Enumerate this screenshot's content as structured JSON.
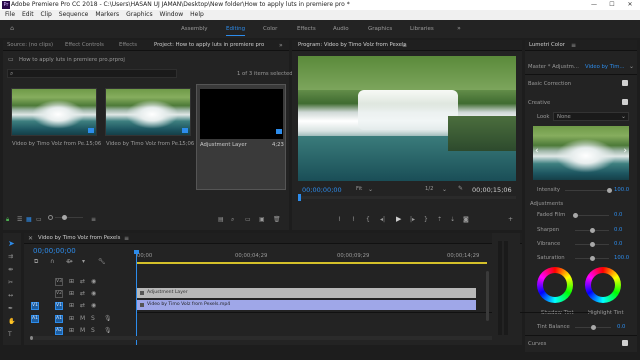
{
  "titlebar": {
    "title": "Adobe Premiere Pro CC 2018 - C:\\Users\\HASAN UJ JAMAN\\Desktop\\New folder\\How to apply luts in premiere pro *",
    "app_icon": "Pr"
  },
  "menubar": [
    "File",
    "Edit",
    "Clip",
    "Sequence",
    "Markers",
    "Graphics",
    "Window",
    "Help"
  ],
  "workspaces": {
    "items": [
      "Assembly",
      "Editing",
      "Color",
      "Effects",
      "Audio",
      "Graphics",
      "Libraries"
    ],
    "active": "Editing"
  },
  "project_panel": {
    "tabs": [
      "Source: (no clips)",
      "Effect Controls",
      "Effects",
      "Project: How to apply luts in premiere pro"
    ],
    "project_file": "How to apply luts in premiere pro.prproj",
    "search_placeholder": "",
    "selection_info": "1 of 3 items selected",
    "items": [
      {
        "name": "Video by Timo Volz from Pe...",
        "duration": "15;06"
      },
      {
        "name": "Video by Timo Volz from Pe...",
        "duration": "15;06"
      },
      {
        "name": "Adjustment Layer",
        "duration": "4;23"
      }
    ]
  },
  "program_monitor": {
    "tab": "Program: Video by Timo Volz from Pexels",
    "timecode": "00;00;00;00",
    "fit": "Fit",
    "resolution": "1/2",
    "duration": "00;00;15;06"
  },
  "lumetri": {
    "tab": "Lumetri Color",
    "master": "Master * Adjustm...",
    "clip": "Video by Tim...",
    "basic_correction": "Basic Correction",
    "creative": "Creative",
    "look_label": "Look",
    "look_value": "None",
    "intensity_label": "Intensity",
    "intensity_value": "100.0",
    "intensity": 1.0,
    "adjustments": "Adjustments",
    "params": [
      {
        "label": "Faded Film",
        "value": "0.0",
        "level": 0.0
      },
      {
        "label": "Sharpen",
        "value": "0.0",
        "level": 0.5
      },
      {
        "label": "Vibrance",
        "value": "0.0",
        "level": 0.5
      },
      {
        "label": "Saturation",
        "value": "100.0",
        "level": 0.5
      }
    ],
    "shadow_tint": "Shadow Tint",
    "highlight_tint": "Highlight Tint",
    "tint_balance_label": "Tint Balance",
    "tint_balance_value": "0.0",
    "curves": "Curves"
  },
  "timeline": {
    "tab": "Video by Timo Volz from Pexels",
    "timecode": "00;00;00;00",
    "ruler": [
      "00;00",
      "00;00;04;29",
      "00;00;09;29",
      "00;00;14;29"
    ],
    "tracks": {
      "video": [
        {
          "name": "V3"
        },
        {
          "name": "V2"
        },
        {
          "name": "V1"
        }
      ],
      "audio": [
        {
          "name": "A1"
        },
        {
          "name": "A2"
        }
      ]
    },
    "clips": {
      "adjustment": "Adjustment Layer",
      "video": "Video by Timo Volz from Pexels.mp4"
    }
  },
  "colors": {
    "accent": "#2d8ceb",
    "panel": "#232323",
    "background": "#1d1d1d"
  }
}
